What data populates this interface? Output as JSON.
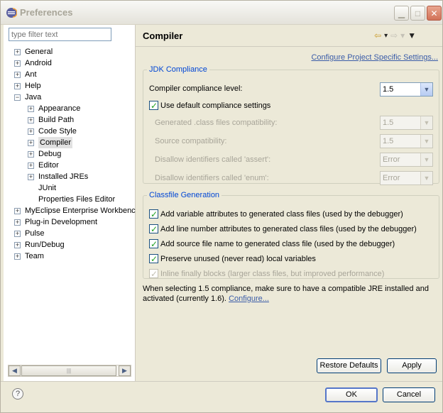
{
  "window": {
    "title": "Preferences",
    "buttons": {
      "minimize": "▁",
      "maximize": "□",
      "close": "✕"
    }
  },
  "left": {
    "filter_placeholder": "type filter text",
    "tree": [
      {
        "label": "General",
        "level": 0,
        "expander": "+"
      },
      {
        "label": "Android",
        "level": 0,
        "expander": "+"
      },
      {
        "label": "Ant",
        "level": 0,
        "expander": "+"
      },
      {
        "label": "Help",
        "level": 0,
        "expander": "+"
      },
      {
        "label": "Java",
        "level": 0,
        "expander": "−"
      },
      {
        "label": "Appearance",
        "level": 1,
        "expander": "+"
      },
      {
        "label": "Build Path",
        "level": 1,
        "expander": "+"
      },
      {
        "label": "Code Style",
        "level": 1,
        "expander": "+"
      },
      {
        "label": "Compiler",
        "level": 1,
        "expander": "+",
        "selected": true
      },
      {
        "label": "Debug",
        "level": 1,
        "expander": "+"
      },
      {
        "label": "Editor",
        "level": 1,
        "expander": "+"
      },
      {
        "label": "Installed JREs",
        "level": 1,
        "expander": "+"
      },
      {
        "label": "JUnit",
        "level": 1,
        "expander": ""
      },
      {
        "label": "Properties Files Editor",
        "level": 1,
        "expander": ""
      },
      {
        "label": "MyEclipse Enterprise Workbenc",
        "level": 0,
        "expander": "+"
      },
      {
        "label": "Plug-in Development",
        "level": 0,
        "expander": "+"
      },
      {
        "label": "Pulse",
        "level": 0,
        "expander": "+"
      },
      {
        "label": "Run/Debug",
        "level": 0,
        "expander": "+"
      },
      {
        "label": "Team",
        "level": 0,
        "expander": "+"
      }
    ]
  },
  "right": {
    "title": "Compiler",
    "configure_project_link": "Configure Project Specific Settings...",
    "jdk": {
      "legend": "JDK Compliance",
      "compliance_level_label": "Compiler compliance level:",
      "compliance_level_value": "1.5",
      "use_default_label": "Use default compliance settings",
      "use_default_checked": true,
      "generated_label": "Generated .class files compatibility:",
      "generated_value": "1.5",
      "source_label": "Source compatibility:",
      "source_value": "1.5",
      "assert_label": "Disallow identifiers called 'assert':",
      "assert_value": "Error",
      "enum_label": "Disallow identifiers called 'enum':",
      "enum_value": "Error"
    },
    "classfile": {
      "legend": "Classfile Generation",
      "options": [
        {
          "label": "Add variable attributes to generated class files (used by the debugger)",
          "checked": true,
          "disabled": false
        },
        {
          "label": "Add line number attributes to generated class files (used by the debugger)",
          "checked": true,
          "disabled": false
        },
        {
          "label": "Add source file name to generated class file (used by the debugger)",
          "checked": true,
          "disabled": false
        },
        {
          "label": "Preserve unused (never read) local variables",
          "checked": true,
          "disabled": false
        },
        {
          "label": "Inline finally blocks (larger class files, but improved performance)",
          "checked": true,
          "disabled": true
        }
      ]
    },
    "note_line1": "When selecting 1.5 compliance, make sure to have a compatible JRE installed and",
    "note_line2": "activated (currently 1.6).",
    "note_link": "Configure...",
    "restore_defaults": "Restore Defaults",
    "apply": "Apply"
  },
  "footer": {
    "help": "?",
    "ok": "OK",
    "cancel": "Cancel"
  }
}
